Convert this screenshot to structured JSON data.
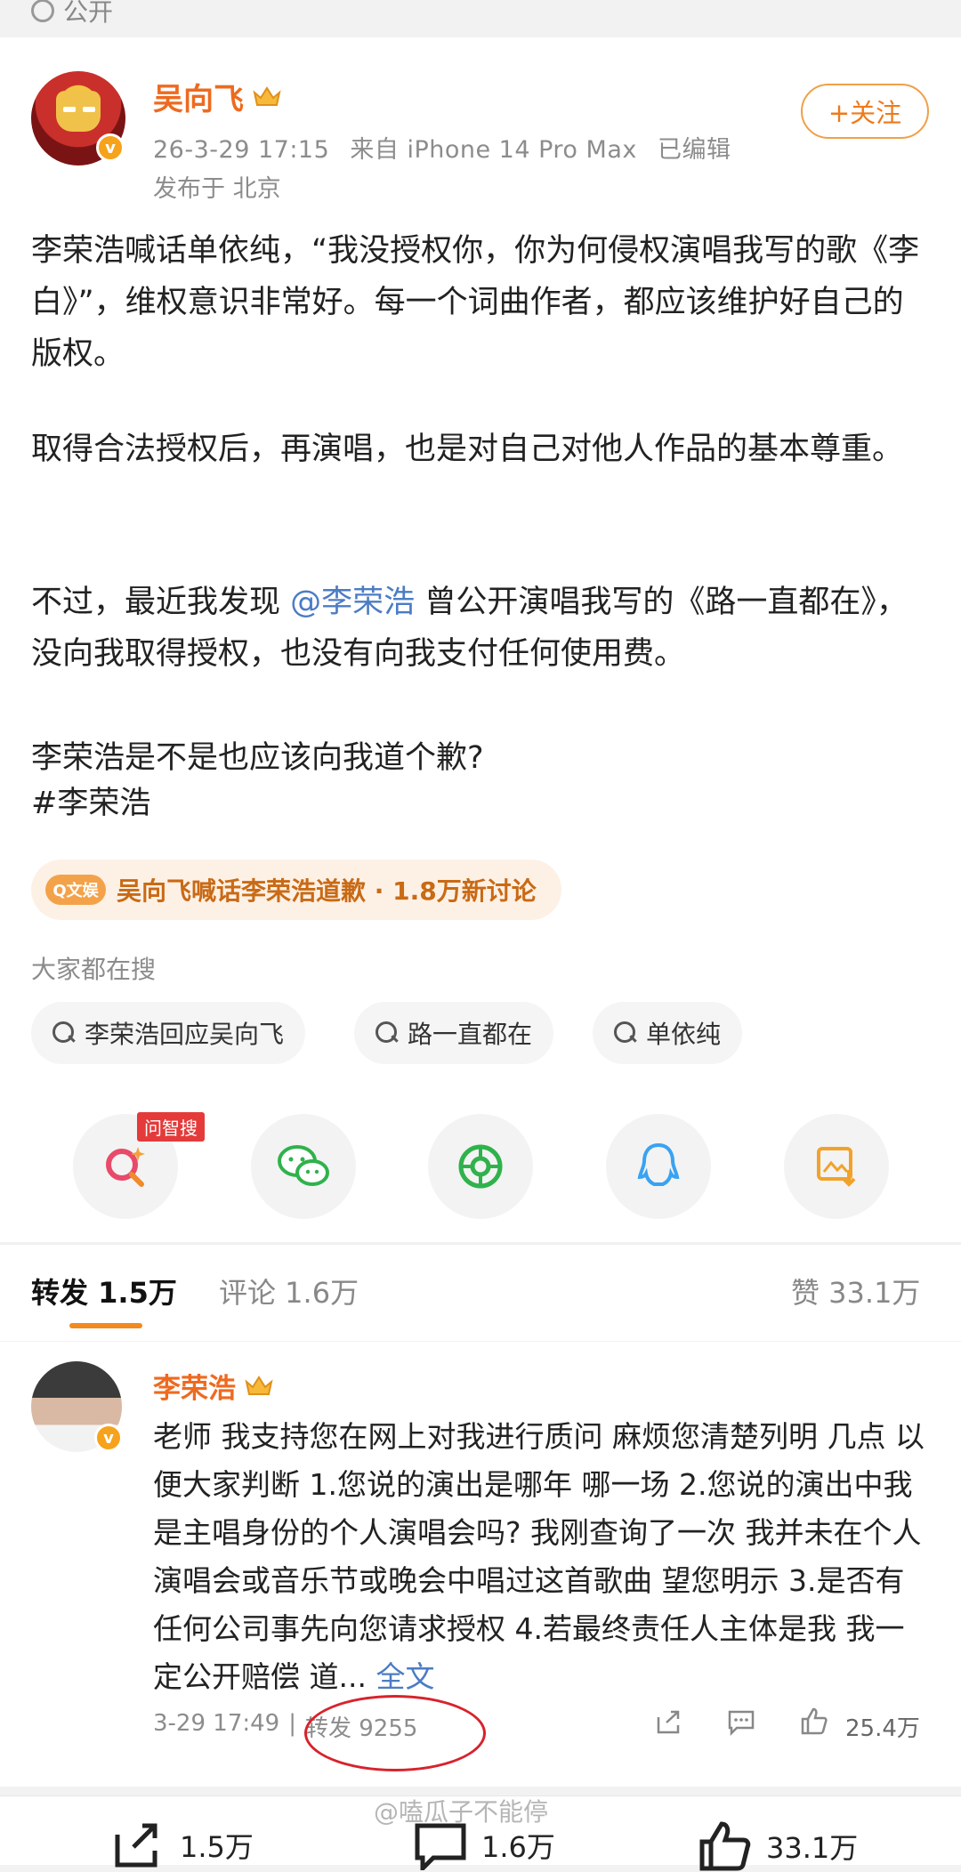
{
  "post": {
    "visibility": "公开",
    "author": "吴向飞",
    "date": "26-3-29 17:15",
    "source": "来自 iPhone 14 Pro Max",
    "edited": "已编辑",
    "location": "发布于 北京",
    "follow_label": "+关注",
    "para1": "李荣浩喊话单依纯，“我没授权你，你为何侵权演唱我写的歌《李白》”，维权意识非常好。每一个词曲作者，都应该维护好自己的版权。",
    "para2": "取得合法授权后，再演唱，也是对自己对他人作品的基本尊重。",
    "para3_a": "不过，最近我发现",
    "para3_mention": "@李荣浩",
    "para3_b": "曾公开演唱我写的《路一直都在》，没向我取得授权，也没有向我支付任何使用费。",
    "para4": "李荣浩是不是也应该向我道个歉?",
    "hashtag": "#李荣浩",
    "topic_tag": "Q文娱",
    "topic_text": "吴向飞喊话李荣浩道歉 · 1.8万新讨论",
    "search_heading": "大家都在搜",
    "search_chips": [
      "李荣浩回应吴向飞",
      "路一直都在",
      "单依纯"
    ],
    "ai_badge": "问智搜"
  },
  "tabs": {
    "repost": "转发 1.5万",
    "comment": "评论 1.6万",
    "like": "赞 33.1万"
  },
  "comment": {
    "author": "李荣浩",
    "text": "老师 我支持您在网上对我进行质问 麻烦您清楚列明 几点 以便大家判断 1.您说的演出是哪年 哪一场 2.您说的演出中我是主唱身份的个人演唱会吗? 我刚查询了一次 我并未在个人演唱会或音乐节或晚会中唱过这首歌曲 望您明示 3.是否有任何公司事先向您请求授权 4.若最终责任人主体是我 我一定公开赔偿 道...",
    "full_text_link": "全文",
    "time": "3-29 17:49",
    "reposts": "转发 9255",
    "likes": "25.4万"
  },
  "bottom": {
    "repost_count": "1.5万",
    "comment_count": "1.6万",
    "like_count": "33.1万",
    "watermark": "@嗑瓜子不能停"
  },
  "colors": {
    "accent": "#ee6a1f",
    "link": "#4b7cc4",
    "annotation": "#d8222b"
  }
}
